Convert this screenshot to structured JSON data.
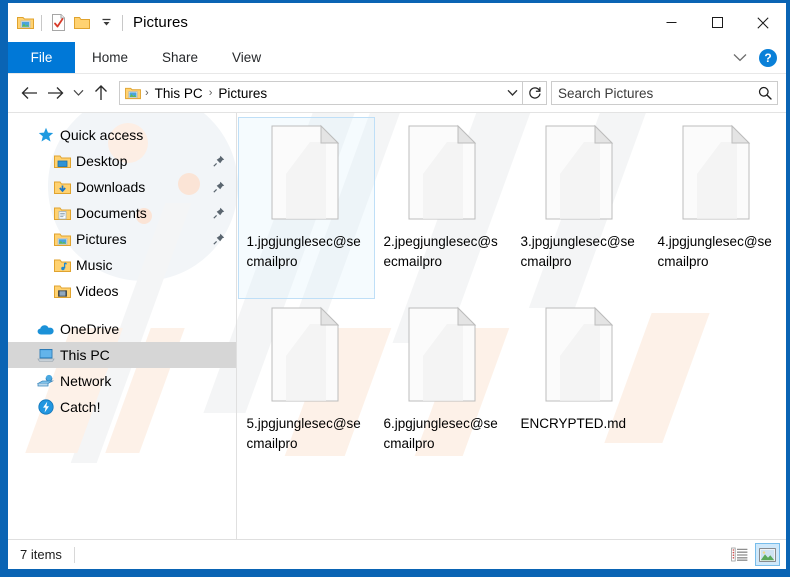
{
  "window": {
    "title": "Pictures",
    "quick_access_icons": [
      "pictures-folder-icon",
      "properties-icon",
      "new-folder-icon",
      "customize-qat-chevron-icon"
    ],
    "controls": {
      "minimize": "minimize-button",
      "maximize": "maximize-button",
      "close": "close-button"
    },
    "accent_color": "#0a64b4",
    "tab_active_color": "#0078d7"
  },
  "ribbon": {
    "tabs": [
      {
        "label": "File",
        "active": true
      },
      {
        "label": "Home",
        "active": false
      },
      {
        "label": "Share",
        "active": false
      },
      {
        "label": "View",
        "active": false
      }
    ],
    "collapse_icon": "chevron-down-icon",
    "help_label": "?"
  },
  "navigation": {
    "back": "back-arrow-icon",
    "forward": "forward-arrow-icon",
    "recent": "recent-locations-chevron-icon",
    "up": "up-arrow-icon",
    "breadcrumb": {
      "icon": "pictures-folder-icon",
      "parts": [
        "This PC",
        "Pictures"
      ],
      "separator": "›"
    },
    "dropdown_icon": "chevron-down-icon",
    "refresh_icon": "refresh-icon"
  },
  "search": {
    "placeholder": "Search Pictures",
    "value": "",
    "icon": "search-icon"
  },
  "sidebar": {
    "items": [
      {
        "label": "Quick access",
        "icon": "star-icon",
        "level": 0,
        "pinned": false,
        "selected": false
      },
      {
        "label": "Desktop",
        "icon": "desktop-folder-icon",
        "level": 1,
        "pinned": true,
        "selected": false
      },
      {
        "label": "Downloads",
        "icon": "downloads-folder-icon",
        "level": 1,
        "pinned": true,
        "selected": false
      },
      {
        "label": "Documents",
        "icon": "documents-folder-icon",
        "level": 1,
        "pinned": true,
        "selected": false
      },
      {
        "label": "Pictures",
        "icon": "pictures-folder-icon",
        "level": 1,
        "pinned": true,
        "selected": false
      },
      {
        "label": "Music",
        "icon": "music-folder-icon",
        "level": 1,
        "pinned": false,
        "selected": false
      },
      {
        "label": "Videos",
        "icon": "videos-folder-icon",
        "level": 1,
        "pinned": false,
        "selected": false
      },
      {
        "label": "OneDrive",
        "icon": "onedrive-cloud-icon",
        "level": 0,
        "pinned": false,
        "selected": false
      },
      {
        "label": "This PC",
        "icon": "this-pc-icon",
        "level": 0,
        "pinned": false,
        "selected": true
      },
      {
        "label": "Network",
        "icon": "network-icon",
        "level": 0,
        "pinned": false,
        "selected": false
      },
      {
        "label": "Catch!",
        "icon": "catch-lightning-icon",
        "level": 0,
        "pinned": false,
        "selected": false
      }
    ]
  },
  "files": [
    {
      "name": "1.jpgjunglesec@secmailpro",
      "icon": "blank-file-icon",
      "selected": true
    },
    {
      "name": "2.jpegjunglesec@secmailpro",
      "icon": "blank-file-icon",
      "selected": false
    },
    {
      "name": "3.jpgjunglesec@secmailpro",
      "icon": "blank-file-icon",
      "selected": false
    },
    {
      "name": "4.jpgjunglesec@secmailpro",
      "icon": "blank-file-icon",
      "selected": false
    },
    {
      "name": "5.jpgjunglesec@secmailpro",
      "icon": "blank-file-icon",
      "selected": false
    },
    {
      "name": "6.jpgjunglesec@secmailpro",
      "icon": "blank-file-icon",
      "selected": false
    },
    {
      "name": "ENCRYPTED.md",
      "icon": "blank-file-icon",
      "selected": false
    }
  ],
  "status": {
    "item_count": "7 items",
    "views": [
      {
        "name": "details-view-button",
        "active": false
      },
      {
        "name": "large-icons-view-button",
        "active": true
      }
    ]
  }
}
